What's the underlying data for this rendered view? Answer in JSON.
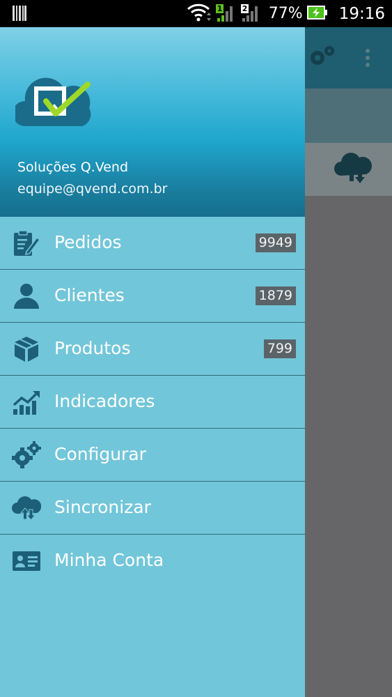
{
  "status_bar": {
    "battery": "77%",
    "time": "19:16",
    "sim1": "1",
    "sim2": "2"
  },
  "drawer": {
    "header": {
      "user_name": "Soluções Q.Vend",
      "user_email": "equipe@qvend.com.br",
      "colors": {
        "gradient_top": "#7fd0e6",
        "gradient_bottom": "#166e8c"
      }
    },
    "items": [
      {
        "label": "Pedidos",
        "badge": "9949",
        "icon": "clipboard-edit-icon"
      },
      {
        "label": "Clientes",
        "badge": "1879",
        "icon": "person-icon"
      },
      {
        "label": "Produtos",
        "badge": "799",
        "icon": "box-icon"
      },
      {
        "label": "Indicadores",
        "badge": "",
        "icon": "chart-icon"
      },
      {
        "label": "Configurar",
        "badge": "",
        "icon": "gears-icon"
      },
      {
        "label": "Sincronizar",
        "badge": "",
        "icon": "cloud-sync-icon"
      },
      {
        "label": "Minha Conta",
        "badge": "",
        "icon": "id-card-icon"
      }
    ],
    "colors": {
      "background": "#72c6d9",
      "icon": "#1d5f77",
      "badge_bg": "#5a6468"
    }
  },
  "background_app": {
    "colors": {
      "toolbar": "#1f5d70",
      "scrim": "#666668"
    }
  }
}
